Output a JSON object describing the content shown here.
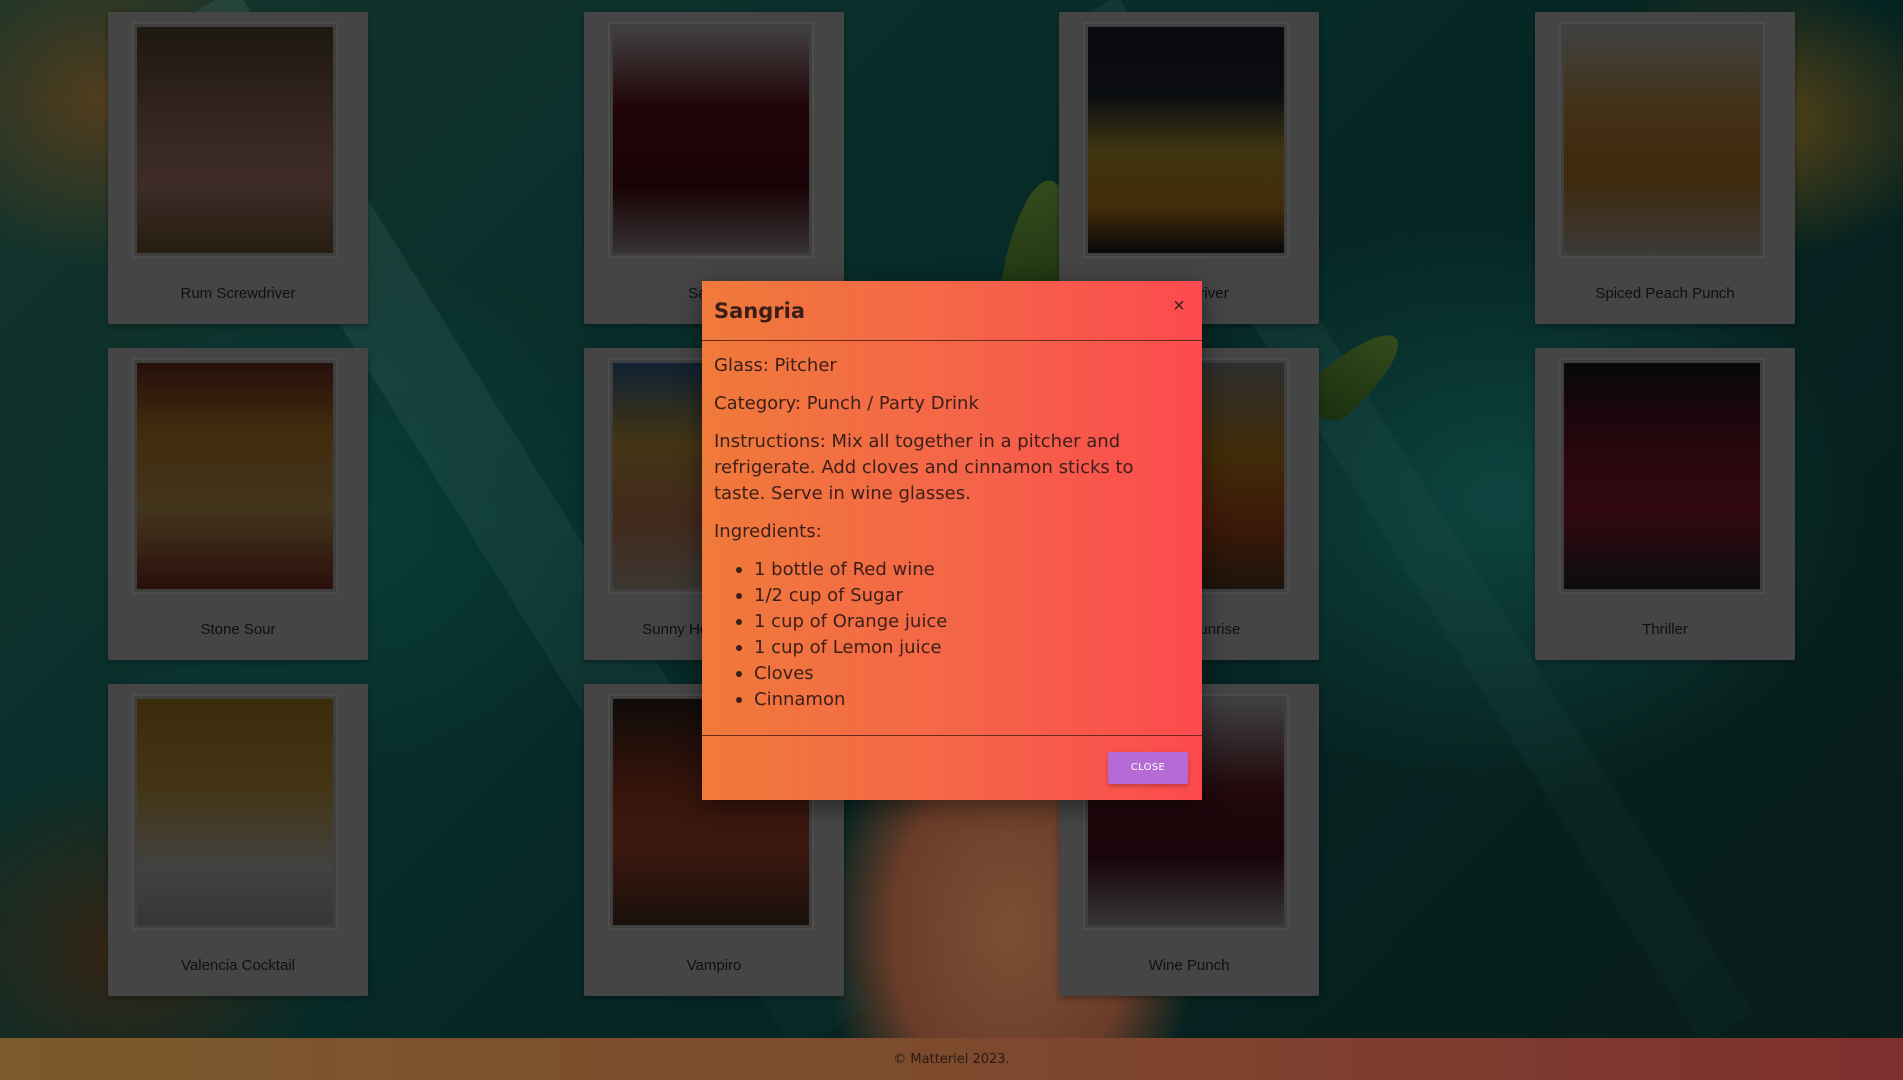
{
  "drinks": [
    {
      "name": "Rum Screwdriver"
    },
    {
      "name": "Sangria"
    },
    {
      "name": "Screwdriver"
    },
    {
      "name": "Spiced Peach Punch"
    },
    {
      "name": "Stone Sour"
    },
    {
      "name": "Sunny Holiday Punch"
    },
    {
      "name": "Tequila Sunrise"
    },
    {
      "name": "Thriller"
    },
    {
      "name": "Valencia Cocktail"
    },
    {
      "name": "Vampiro"
    },
    {
      "name": "Wine Punch"
    }
  ],
  "modal": {
    "title": "Sangria",
    "close_icon": "×",
    "glass": "Glass: Pitcher",
    "category": "Category: Punch / Party Drink",
    "instructions": "Instructions: Mix all together in a pitcher and refrigerate. Add cloves and cinnamon sticks to taste. Serve in wine glasses.",
    "ingredients_label": "Ingredients:",
    "ingredients": [
      "1 bottle of Red wine",
      "1/2 cup of Sugar",
      "1 cup of Orange juice",
      "1 cup of Lemon juice",
      "Cloves",
      "Cinnamon"
    ],
    "close_button": "CLOSE"
  },
  "footer": {
    "copyright": "© Matteriel 2023."
  },
  "colors": {
    "modal_gradient_start": "#f07a3a",
    "modal_gradient_end": "#fc4a4e",
    "close_button": "#b56ad6",
    "footer_start": "#7b5a2c",
    "footer_end": "#7f2f2e"
  }
}
